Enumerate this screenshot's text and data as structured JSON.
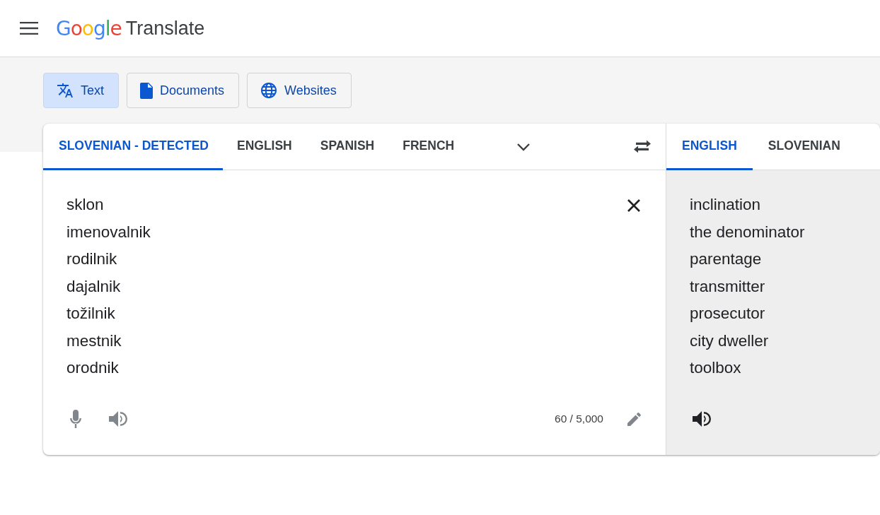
{
  "logo": {
    "brand": "Google",
    "product": "Translate"
  },
  "modes": [
    {
      "label": "Text",
      "kind": "text",
      "selected": true
    },
    {
      "label": "Documents",
      "kind": "documents",
      "selected": false
    },
    {
      "label": "Websites",
      "kind": "websites",
      "selected": false
    }
  ],
  "source": {
    "languages": [
      {
        "label": "SLOVENIAN - DETECTED",
        "selected": true
      },
      {
        "label": "ENGLISH",
        "selected": false
      },
      {
        "label": "SPANISH",
        "selected": false
      },
      {
        "label": "FRENCH",
        "selected": false
      }
    ],
    "text_lines": [
      "sklon",
      "imenovalnik",
      "rodilnik",
      "dajalnik",
      "tožilnik",
      "mestnik",
      "orodnik"
    ],
    "char_count": "60 / 5,000"
  },
  "target": {
    "languages": [
      {
        "label": "ENGLISH",
        "selected": true
      },
      {
        "label": "SLOVENIAN",
        "selected": false
      }
    ],
    "text_lines": [
      "inclination",
      "the denominator",
      "parentage",
      "transmitter",
      "prosecutor",
      "city dweller",
      "toolbox"
    ]
  }
}
